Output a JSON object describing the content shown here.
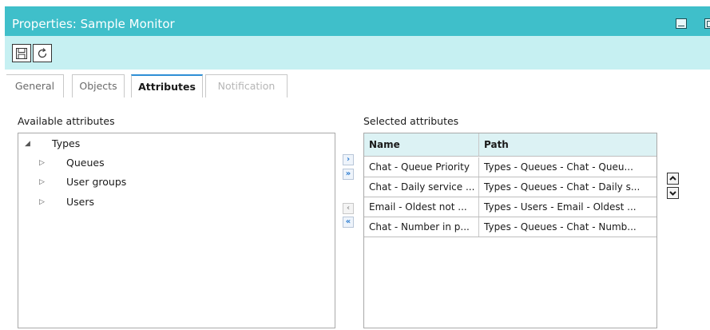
{
  "window": {
    "title": "Properties: Sample Monitor",
    "accent_color": "#3fbfca",
    "toolbar_color": "#c6f0f2"
  },
  "toolbar": {
    "save_icon": "save-icon",
    "refresh_icon": "refresh-icon"
  },
  "tabs": [
    {
      "label": "General",
      "active": false,
      "enabled": true
    },
    {
      "label": "Objects",
      "active": false,
      "enabled": true
    },
    {
      "label": "Attributes",
      "active": true,
      "enabled": true
    },
    {
      "label": "Notification",
      "active": false,
      "enabled": false
    }
  ],
  "available": {
    "label": "Available attributes",
    "tree": {
      "root": {
        "label": "Types",
        "expanded": true
      },
      "children": [
        {
          "label": "Queues",
          "expanded": false
        },
        {
          "label": "User groups",
          "expanded": false
        },
        {
          "label": "Users",
          "expanded": false
        }
      ]
    }
  },
  "move_buttons": {
    "add": "›",
    "add_all": "»",
    "remove": "‹",
    "remove_all": "«"
  },
  "selected": {
    "label": "Selected attributes",
    "columns": [
      "Name",
      "Path"
    ],
    "rows": [
      {
        "name": "Chat - Queue Priority",
        "path": "Types - Queues - Chat - Queu..."
      },
      {
        "name": "Chat - Daily service ...",
        "path": "Types - Queues - Chat - Daily s..."
      },
      {
        "name": "Email - Oldest not ...",
        "path": "Types - Users - Email - Oldest ..."
      },
      {
        "name": "Chat - Number in p...",
        "path": "Types - Queues - Chat - Numb..."
      }
    ]
  },
  "order_buttons": {
    "up_icon": "chevron-up-icon",
    "down_icon": "chevron-down-icon"
  }
}
